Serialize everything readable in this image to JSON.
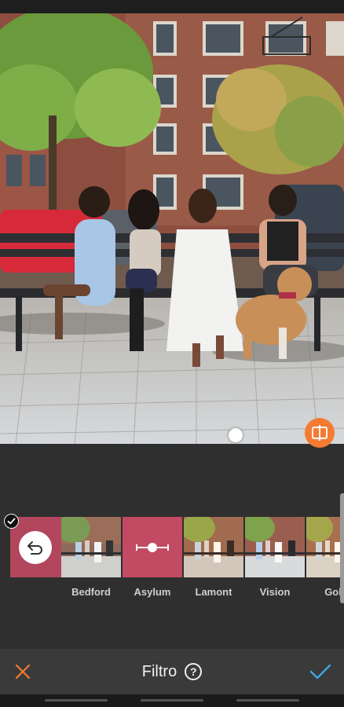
{
  "screen": {
    "title": "Filtro",
    "accent_color": "#f47b31",
    "confirm_color": "#3fa6e0",
    "background": "#2f2f2f"
  },
  "icons": {
    "cancel": "close-icon",
    "help": "?",
    "confirm": "check-icon",
    "compare": "compare-icon",
    "original": "undo-arrow-icon",
    "selected": "check-badge-icon"
  },
  "filters": [
    {
      "label": "",
      "kind": "original"
    },
    {
      "label": "Bedford",
      "kind": "photo"
    },
    {
      "label": "Asylum",
      "kind": "slider"
    },
    {
      "label": "Lamont",
      "kind": "photo"
    },
    {
      "label": "Vision",
      "kind": "photo"
    },
    {
      "label": "Gobl",
      "kind": "photo"
    }
  ]
}
